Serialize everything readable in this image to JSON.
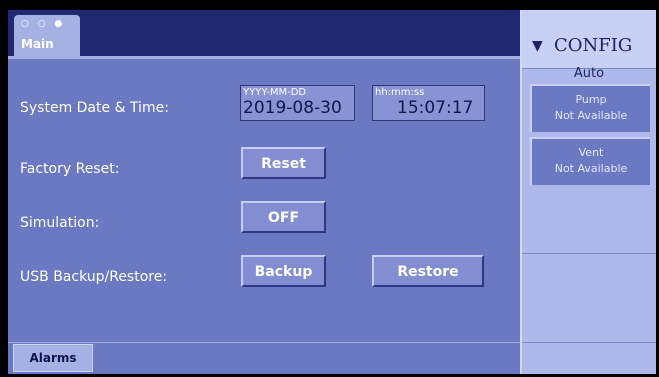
{
  "main_tab": {
    "dots": "○ ○ ●",
    "label": "Main"
  },
  "rows": {
    "datetime": {
      "label": "System Date & Time:",
      "date_format": "YYYY-MM-DD",
      "date_value": "2019-08-30",
      "time_format": "hh:mm:ss",
      "time_value": "15:07:17"
    },
    "factory_reset": {
      "label": "Factory Reset:",
      "button": "Reset"
    },
    "simulation": {
      "label": "Simulation:",
      "button": "OFF"
    },
    "usb": {
      "label": "USB Backup/Restore:",
      "backup_button": "Backup",
      "restore_button": "Restore"
    }
  },
  "bottom": {
    "alarms_tab": "Alarms"
  },
  "config": {
    "title": "CONFIG",
    "arrow_icon": "chevron-down-icon",
    "mode": "Auto",
    "items": [
      {
        "name": "Pump",
        "status": "Not Available"
      },
      {
        "name": "Vent",
        "status": "Not Available"
      }
    ]
  },
  "colors": {
    "panel": "#6b78c2",
    "topbar": "#202a73",
    "tab": "#a6b1e3",
    "sidebar": "#aeb8ea"
  }
}
